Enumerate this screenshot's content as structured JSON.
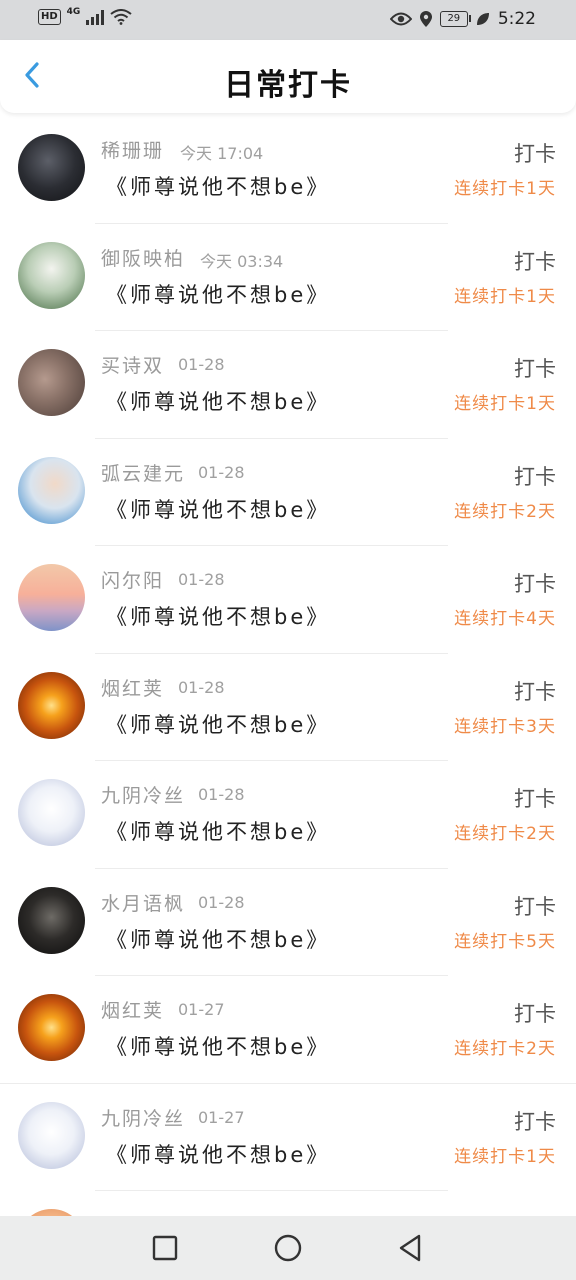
{
  "status_bar": {
    "hd": "HD",
    "network": "4G",
    "battery": "29",
    "time": "5:22"
  },
  "header": {
    "title": "日常打卡"
  },
  "entries": [
    {
      "name": "稀珊珊",
      "date": "今天 17:04",
      "book": "《师尊说他不想be》",
      "action": "打卡",
      "streak": "连续打卡1天"
    },
    {
      "name": "御阪映柏",
      "date": "今天 03:34",
      "book": "《师尊说他不想be》",
      "action": "打卡",
      "streak": "连续打卡1天"
    },
    {
      "name": "买诗双",
      "date": "01-28",
      "book": "《师尊说他不想be》",
      "action": "打卡",
      "streak": "连续打卡1天"
    },
    {
      "name": "弧云建元",
      "date": "01-28",
      "book": "《师尊说他不想be》",
      "action": "打卡",
      "streak": "连续打卡2天"
    },
    {
      "name": "闪尔阳",
      "date": "01-28",
      "book": "《师尊说他不想be》",
      "action": "打卡",
      "streak": "连续打卡4天"
    },
    {
      "name": "烟红荚",
      "date": "01-28",
      "book": "《师尊说他不想be》",
      "action": "打卡",
      "streak": "连续打卡3天"
    },
    {
      "name": "九阴冷丝",
      "date": "01-28",
      "book": "《师尊说他不想be》",
      "action": "打卡",
      "streak": "连续打卡2天"
    },
    {
      "name": "水月语枫",
      "date": "01-28",
      "book": "《师尊说他不想be》",
      "action": "打卡",
      "streak": "连续打卡5天"
    },
    {
      "name": "烟红荚",
      "date": "01-27",
      "book": "《师尊说他不想be》",
      "action": "打卡",
      "streak": "连续打卡2天"
    },
    {
      "name": "九阴冷丝",
      "date": "01-27",
      "book": "《师尊说他不想be》",
      "action": "打卡",
      "streak": "连续打卡1天"
    }
  ],
  "colors": {
    "accent": "#ef8a48",
    "back": "#3a9be0"
  },
  "icons": {
    "back": "chevron-left-icon",
    "nav_recent": "square-icon",
    "nav_home": "circle-icon",
    "nav_back": "triangle-back-icon"
  }
}
